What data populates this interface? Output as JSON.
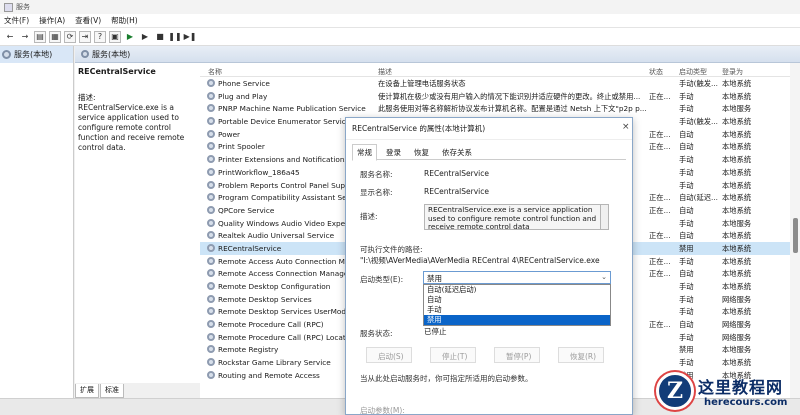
{
  "window": {
    "title": "服务"
  },
  "menu": [
    "文件(F)",
    "操作(A)",
    "查看(V)",
    "帮助(H)"
  ],
  "tree": {
    "root_label": "服务(本地)"
  },
  "header_band": {
    "label": "服务(本地)"
  },
  "left_desc": {
    "service_name": "RECentralService",
    "desc_label": "描述:",
    "desc_text": "RECentralService.exe is a service application used to configure remote control function and receive remote control data."
  },
  "bottom_tabs": [
    "扩展",
    "标准"
  ],
  "columns": {
    "name": "名称",
    "desc": "描述",
    "status": "状态",
    "startup": "启动类型",
    "logon": "登录为"
  },
  "services": [
    {
      "name": "Phone Service",
      "desc": "在设备上管理电话服务状态",
      "status": "",
      "startup": "手动(触发...",
      "logon": "本地系统"
    },
    {
      "name": "Plug and Play",
      "desc": "使计算机在极少或没有用户输入的情况下能识别并适应硬件的更改。终止或禁用...",
      "status": "正在...",
      "startup": "手动",
      "logon": "本地系统"
    },
    {
      "name": "PNRP Machine Name Publication Service",
      "desc": "此服务使用对等名称解析协议发布计算机名称。配置是通过 Netsh 上下文\"p2p p...",
      "status": "",
      "startup": "手动",
      "logon": "本地服务"
    },
    {
      "name": "Portable Device Enumerator Service",
      "desc": "",
      "status": "",
      "startup": "手动(触发...",
      "logon": "本地系统"
    },
    {
      "name": "Power",
      "desc": "",
      "status": "正在...",
      "startup": "自动",
      "logon": "本地系统"
    },
    {
      "name": "Print Spooler",
      "desc": "",
      "status": "正在...",
      "startup": "自动",
      "logon": "本地系统"
    },
    {
      "name": "Printer Extensions and Notifications",
      "desc": "",
      "status": "",
      "startup": "手动",
      "logon": "本地系统"
    },
    {
      "name": "PrintWorkflow_186a45",
      "desc": "",
      "status": "",
      "startup": "手动",
      "logon": "本地系统"
    },
    {
      "name": "Problem Reports Control Panel Suppo",
      "desc": "",
      "status": "",
      "startup": "手动",
      "logon": "本地系统"
    },
    {
      "name": "Program Compatibility Assistant Servi",
      "desc": "",
      "status": "正在...",
      "startup": "自动(延迟...",
      "logon": "本地系统"
    },
    {
      "name": "QPCore Service",
      "desc": "",
      "status": "正在...",
      "startup": "自动",
      "logon": "本地系统"
    },
    {
      "name": "Quality Windows Audio Video Experie",
      "desc": "",
      "status": "",
      "startup": "手动",
      "logon": "本地服务"
    },
    {
      "name": "Realtek Audio Universal Service",
      "desc": "",
      "status": "正在...",
      "startup": "自动",
      "logon": "本地系统"
    },
    {
      "name": "RECentralService",
      "desc": "",
      "status": "",
      "startup": "禁用",
      "logon": "本地系统"
    },
    {
      "name": "Remote Access Auto Connection Mana",
      "desc": "",
      "status": "正在...",
      "startup": "手动",
      "logon": "本地系统"
    },
    {
      "name": "Remote Access Connection Manager",
      "desc": "",
      "status": "正在...",
      "startup": "自动",
      "logon": "本地系统"
    },
    {
      "name": "Remote Desktop Configuration",
      "desc": "",
      "status": "",
      "startup": "手动",
      "logon": "本地系统"
    },
    {
      "name": "Remote Desktop Services",
      "desc": "",
      "status": "",
      "startup": "手动",
      "logon": "网络服务"
    },
    {
      "name": "Remote Desktop Services UserMode P",
      "desc": "",
      "status": "",
      "startup": "手动",
      "logon": "本地系统"
    },
    {
      "name": "Remote Procedure Call (RPC)",
      "desc": "",
      "status": "正在...",
      "startup": "自动",
      "logon": "网络服务"
    },
    {
      "name": "Remote Procedure Call (RPC) Locator",
      "desc": "",
      "status": "",
      "startup": "手动",
      "logon": "网络服务"
    },
    {
      "name": "Remote Registry",
      "desc": "",
      "status": "",
      "startup": "禁用",
      "logon": "本地服务"
    },
    {
      "name": "Rockstar Game Library Service",
      "desc": "",
      "status": "",
      "startup": "手动",
      "logon": "本地系统"
    },
    {
      "name": "Routing and Remote Access",
      "desc": "",
      "status": "",
      "startup": "禁用",
      "logon": "本地系统"
    }
  ],
  "dialog": {
    "title": "RECentralService 的属性(本地计算机)",
    "tabs": [
      "常规",
      "登录",
      "恢复",
      "依存关系"
    ],
    "service_name_label": "服务名称:",
    "service_name": "RECentralService",
    "display_name_label": "显示名称:",
    "display_name": "RECentralService",
    "desc_label": "描述:",
    "desc_text": "RECentralService.exe is a service application used to configure remote control function and receive remote control data",
    "path_label": "可执行文件的路径:",
    "path": "\"I:\\视频\\AVerMedia\\AVerMedia RECentral 4\\RECentralService.exe",
    "startup_label": "启动类型(E):",
    "startup_value": "禁用",
    "startup_options": [
      "自动(延迟启动)",
      "自动",
      "手动",
      "禁用"
    ],
    "status_label": "服务状态:",
    "status_value": "已停止",
    "buttons": [
      "启动(S)",
      "停止(T)",
      "暂停(P)",
      "恢复(R)"
    ],
    "hint": "当从此处启动服务时，你可指定所适用的启动参数。",
    "params_label": "启动参数(M):"
  },
  "watermark": {
    "logo_letter": "Z",
    "cn": "这里教程网",
    "url": "herecours.com"
  }
}
